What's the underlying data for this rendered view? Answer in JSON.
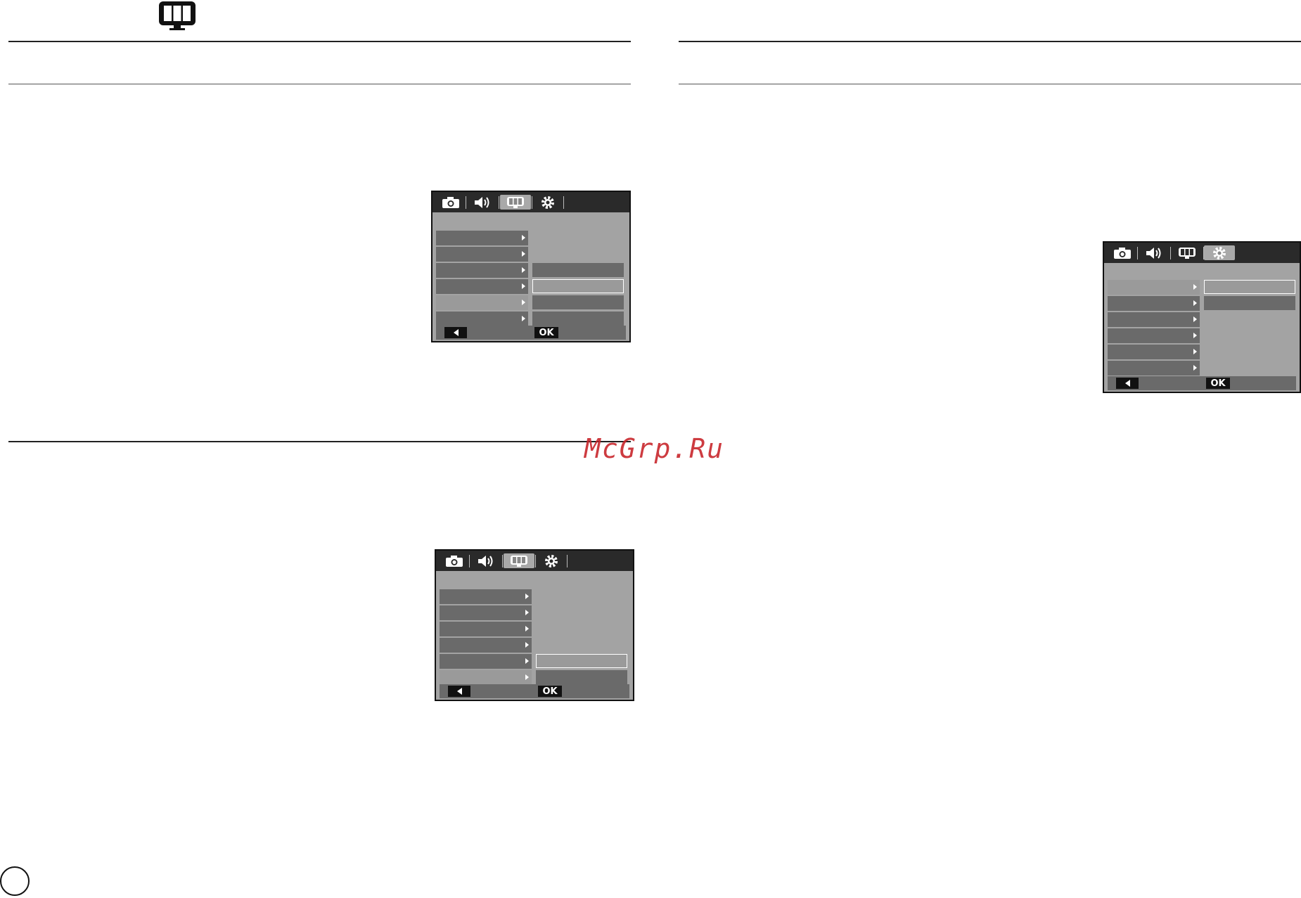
{
  "watermark": {
    "text": "McGrp.Ru"
  },
  "icons": {
    "header": "display-menu-icon",
    "tabs": [
      "camera-icon",
      "sound-icon",
      "display-icon",
      "settings-icon"
    ]
  },
  "lcd": {
    "ok_label": "OK"
  },
  "colors": {
    "watermark": "#c8262c",
    "lcd_body": "#a3a3a3",
    "lcd_bar": "#2a2a2a"
  }
}
